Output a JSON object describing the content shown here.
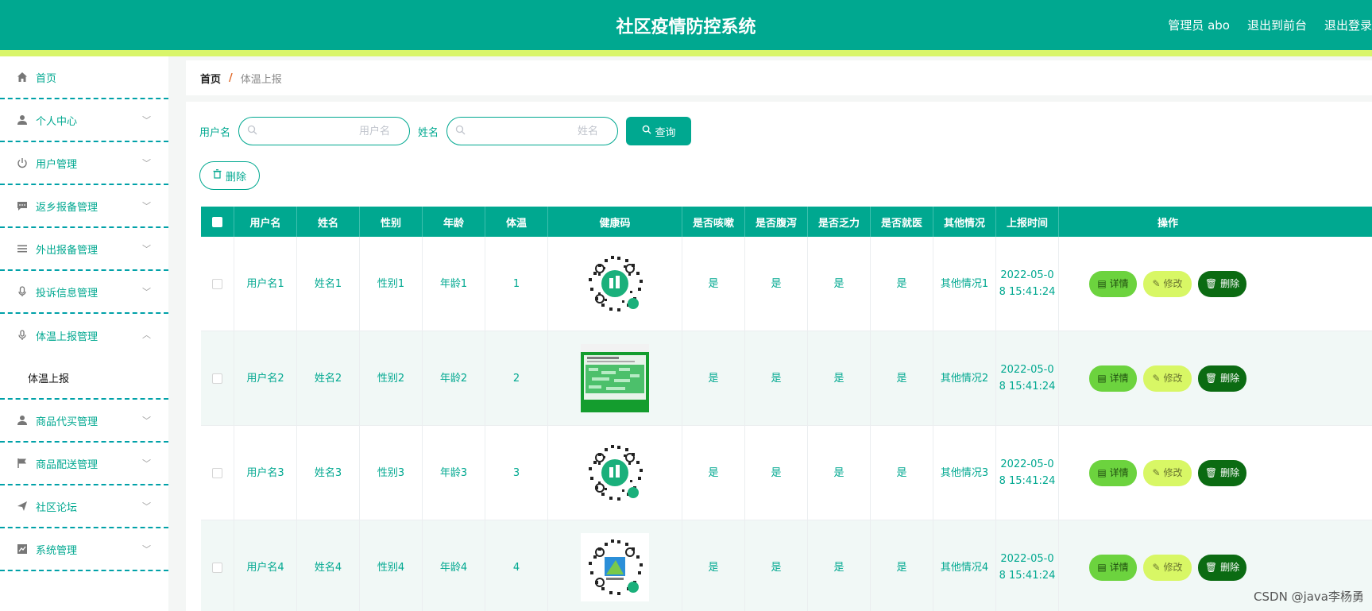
{
  "header": {
    "title": "社区疫情防控系统",
    "admin": "管理员 abo",
    "back_to_front": "退出到前台",
    "logout": "退出登录"
  },
  "sidebar": {
    "items": [
      {
        "label": "首页",
        "icon": "home-icon"
      },
      {
        "label": "个人中心",
        "icon": "user-icon"
      },
      {
        "label": "用户管理",
        "icon": "power-icon"
      },
      {
        "label": "返乡报备管理",
        "icon": "chat-icon"
      },
      {
        "label": "外出报备管理",
        "icon": "menu-icon"
      },
      {
        "label": "投诉信息管理",
        "icon": "mic-icon"
      },
      {
        "label": "体温上报管理",
        "icon": "microphone-icon"
      },
      {
        "label": "商品代买管理",
        "icon": "user-icon"
      },
      {
        "label": "商品配送管理",
        "icon": "flag-icon"
      },
      {
        "label": "社区论坛",
        "icon": "send-icon"
      },
      {
        "label": "系统管理",
        "icon": "chart-icon"
      }
    ],
    "sub_item": "体温上报"
  },
  "breadcrumb": {
    "home": "首页",
    "sep": "/",
    "current": "体温上报"
  },
  "search": {
    "username_label": "用户名",
    "username_placeholder": "用户名",
    "name_label": "姓名",
    "name_placeholder": "姓名",
    "query_button": "查询",
    "delete_button": "删除"
  },
  "table": {
    "headers": [
      "用户名",
      "姓名",
      "性别",
      "年龄",
      "体温",
      "健康码",
      "是否咳嗽",
      "是否腹泻",
      "是否乏力",
      "是否就医",
      "其他情况",
      "上报时间",
      "操作"
    ],
    "rows": [
      {
        "username": "用户名1",
        "name": "姓名1",
        "gender": "性别1",
        "age": "年龄1",
        "temp": "1",
        "cough": "是",
        "diarrhea": "是",
        "fatigue": "是",
        "doctor": "是",
        "other": "其他情况1",
        "time1": "2022-05-0",
        "time2": "8 15:41:24"
      },
      {
        "username": "用户名2",
        "name": "姓名2",
        "gender": "性别2",
        "age": "年龄2",
        "temp": "2",
        "cough": "是",
        "diarrhea": "是",
        "fatigue": "是",
        "doctor": "是",
        "other": "其他情况2",
        "time1": "2022-05-0",
        "time2": "8 15:41:24"
      },
      {
        "username": "用户名3",
        "name": "姓名3",
        "gender": "性别3",
        "age": "年龄3",
        "temp": "3",
        "cough": "是",
        "diarrhea": "是",
        "fatigue": "是",
        "doctor": "是",
        "other": "其他情况3",
        "time1": "2022-05-0",
        "time2": "8 15:41:24"
      },
      {
        "username": "用户名4",
        "name": "姓名4",
        "gender": "性别4",
        "age": "年龄4",
        "temp": "4",
        "cough": "是",
        "diarrhea": "是",
        "fatigue": "是",
        "doctor": "是",
        "other": "其他情况4",
        "time1": "2022-05-0",
        "time2": "8 15:41:24"
      }
    ],
    "ops": {
      "detail": "详情",
      "edit": "修改",
      "delete": "删除"
    }
  },
  "watermark": "CSDN @java李杨勇",
  "colors": {
    "primary": "#00a890",
    "accent": "#d9f56a",
    "detail": "#6cd33e",
    "edit": "#d8f765",
    "delete": "#0b6b12"
  }
}
